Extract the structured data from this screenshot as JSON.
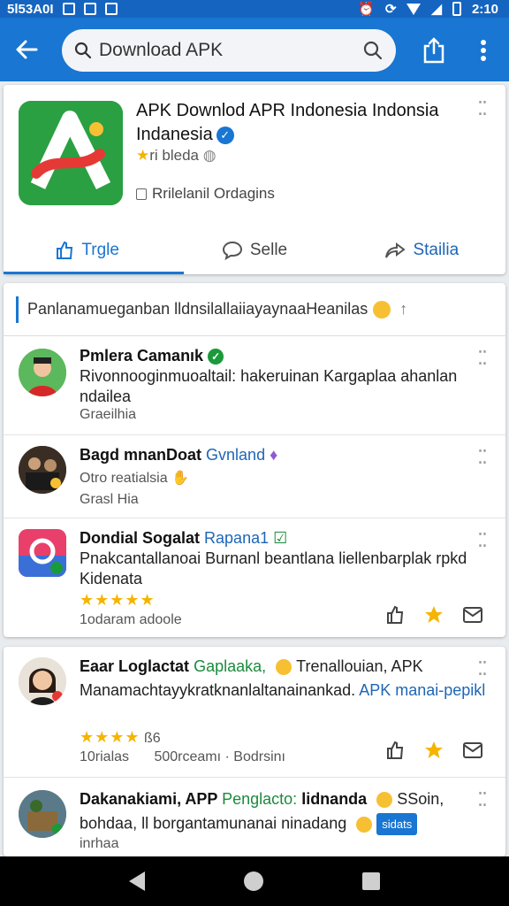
{
  "status_bar": {
    "left_text": "5l53A0I",
    "time": "2:10"
  },
  "search": {
    "placeholder": "Download APK"
  },
  "app": {
    "title_line1": "APK Downlod APR Indonesia Indonsia",
    "title_line2": "Indanesia",
    "meta": "ri bleda",
    "subtitle": "Rrilelanil Ordagins",
    "tabs": [
      {
        "label": "Trgle"
      },
      {
        "label": "Selle"
      },
      {
        "label": "Stailia"
      }
    ]
  },
  "list": {
    "header": "Panlanamueganban lldnsilallaiiayaynaaHeanilas",
    "items": [
      {
        "name": "Pmlera Camanık",
        "text": "Rivonnooginmuoaltail: hakeruinan Kargaplaa ahanlan ndailea",
        "meta": "Graeilhia"
      },
      {
        "name": "Bagd mnanDoat",
        "name_highlight": "Gvnland",
        "meta1": "Otro reatialsia",
        "meta2": "Grasl Hia"
      },
      {
        "name": "Dondial Sogalat",
        "name_highlight": "Rapana1",
        "text": "Pnakcantallanoai Burnanl beantlana liellenbarplak rpkd Kidenata",
        "stars": "★★★★★",
        "meta": "1odaram adoole"
      }
    ]
  },
  "list2": {
    "items": [
      {
        "name": "Eaar Loglactat",
        "name_highlight": "Gaplaaka,",
        "name_suffix": "Trenallouian, APK",
        "text_main": "Manamachtayykratknanlaltanainankad.",
        "text_link": "APK manai-pepikl",
        "stars": "★★★★",
        "star_count": "ß6",
        "meta": "10rialas",
        "meta2": "500rceamı · Bodrsinı"
      },
      {
        "name": "Dakanakiami, APP",
        "name_highlight": "Penglacto:",
        "name_suffix": "lidnanda",
        "name_tail": "SSoin,",
        "text_main": "bohdaa, ll borgantamunanai ninadang",
        "chip": "sidats",
        "meta": "inrhaa"
      }
    ]
  }
}
